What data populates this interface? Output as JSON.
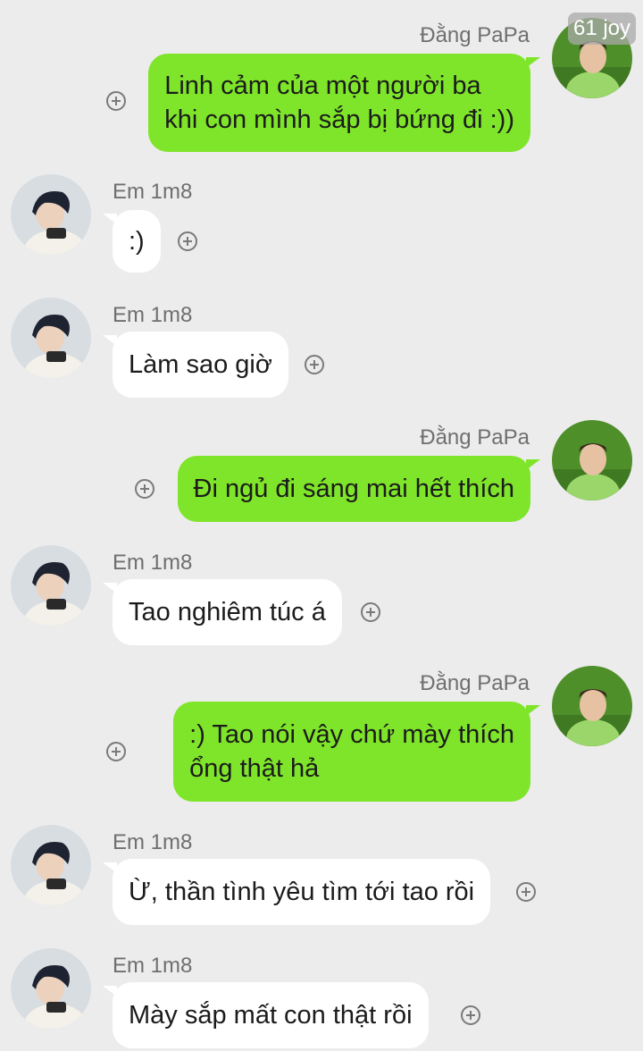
{
  "watermark": "61 joy",
  "senders": {
    "papa": "Đằng PaPa",
    "em": "Em 1m8"
  },
  "messages": [
    {
      "sender": "Đằng PaPa",
      "direction": "outgoing",
      "lines": [
        "Linh cảm của một người ba",
        "khi con mình sắp bị bứng đi :))"
      ]
    },
    {
      "sender": "Em 1m8",
      "direction": "incoming",
      "lines": [
        ":)"
      ]
    },
    {
      "sender": "Em 1m8",
      "direction": "incoming",
      "lines": [
        "Làm sao giờ"
      ]
    },
    {
      "sender": "Đằng PaPa",
      "direction": "outgoing",
      "lines": [
        "Đi ngủ đi sáng mai hết thích"
      ]
    },
    {
      "sender": "Em 1m8",
      "direction": "incoming",
      "lines": [
        "Tao nghiêm túc á"
      ]
    },
    {
      "sender": "Đằng PaPa",
      "direction": "outgoing",
      "lines": [
        ":) Tao nói vậy chứ mày thích",
        "ổng thật hả"
      ]
    },
    {
      "sender": "Em 1m8",
      "direction": "incoming",
      "lines": [
        "Ừ, thần tình yêu tìm tới tao rồi"
      ]
    },
    {
      "sender": "Em 1m8",
      "direction": "incoming",
      "lines": [
        "Mày sắp mất con thật rồi"
      ]
    }
  ],
  "icons": {
    "react": "add-reaction-icon",
    "avatar_papa": "avatar-photo-grass",
    "avatar_em": "avatar-photo-boy-phone"
  },
  "colors": {
    "background": "#ececec",
    "outgoing_bubble": "#7fe52a",
    "incoming_bubble": "#ffffff",
    "name_text": "#6f6f6f",
    "message_text": "#1b1b1b"
  }
}
